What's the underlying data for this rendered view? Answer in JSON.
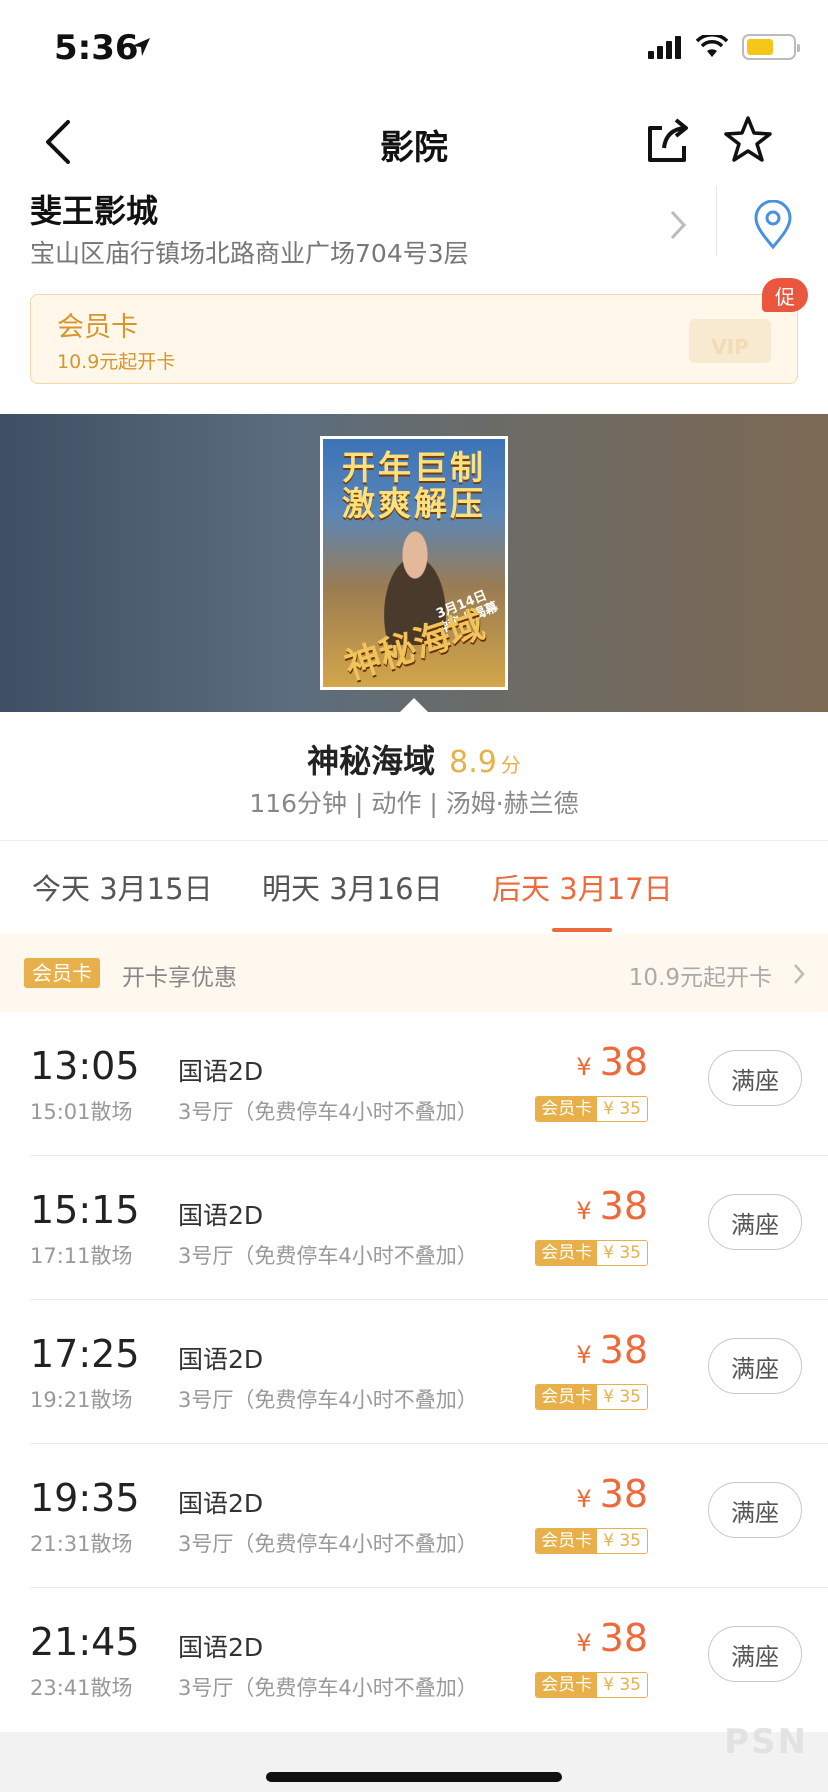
{
  "status_bar": {
    "time": "5:36"
  },
  "nav": {
    "title": "影院"
  },
  "cinema": {
    "name": "斐王影城",
    "address": "宝山区庙行镇场北路商业广场704号3层"
  },
  "member_card": {
    "title": "会员卡",
    "subtitle": "10.9元起开卡",
    "vip_label": "VIP",
    "promo_badge": "促"
  },
  "poster": {
    "line1": "开年巨制",
    "line2": "激爽解压",
    "logo": "神秘海域",
    "date_line1": "3月14日",
    "date_line2": "神秘大揭幕"
  },
  "movie": {
    "title": "神秘海域",
    "score": "8.9",
    "score_unit": "分",
    "meta": "116分钟 | 动作 | 汤姆·赫兰德"
  },
  "date_tabs": [
    {
      "label": "今天 3月15日",
      "active": false
    },
    {
      "label": "明天 3月16日",
      "active": false
    },
    {
      "label": "后天 3月17日",
      "active": true
    }
  ],
  "promo_strip": {
    "tag": "会员卡",
    "text": "开卡享优惠",
    "right": "10.9元起开卡"
  },
  "showtimes": [
    {
      "start": "13:05",
      "end": "15:01散场",
      "lang": "国语2D",
      "hall": "3号厅（免费停车4小时不叠加）",
      "currency": "¥",
      "price": "38",
      "member_tag": "会员卡",
      "member_price": "¥ 35",
      "button": "满座"
    },
    {
      "start": "15:15",
      "end": "17:11散场",
      "lang": "国语2D",
      "hall": "3号厅（免费停车4小时不叠加）",
      "currency": "¥",
      "price": "38",
      "member_tag": "会员卡",
      "member_price": "¥ 35",
      "button": "满座"
    },
    {
      "start": "17:25",
      "end": "19:21散场",
      "lang": "国语2D",
      "hall": "3号厅（免费停车4小时不叠加）",
      "currency": "¥",
      "price": "38",
      "member_tag": "会员卡",
      "member_price": "¥ 35",
      "button": "满座"
    },
    {
      "start": "19:35",
      "end": "21:31散场",
      "lang": "国语2D",
      "hall": "3号厅（免费停车4小时不叠加）",
      "currency": "¥",
      "price": "38",
      "member_tag": "会员卡",
      "member_price": "¥ 35",
      "button": "满座"
    },
    {
      "start": "21:45",
      "end": "23:41散场",
      "lang": "国语2D",
      "hall": "3号厅（免费停车4小时不叠加）",
      "currency": "¥",
      "price": "38",
      "member_tag": "会员卡",
      "member_price": "¥ 35",
      "button": "满座"
    }
  ],
  "watermark": "PSN",
  "colors": {
    "accent": "#ee6a3b",
    "gold": "#e8b04a",
    "promo_red": "#e9573f",
    "pin_blue": "#4a90e2"
  }
}
